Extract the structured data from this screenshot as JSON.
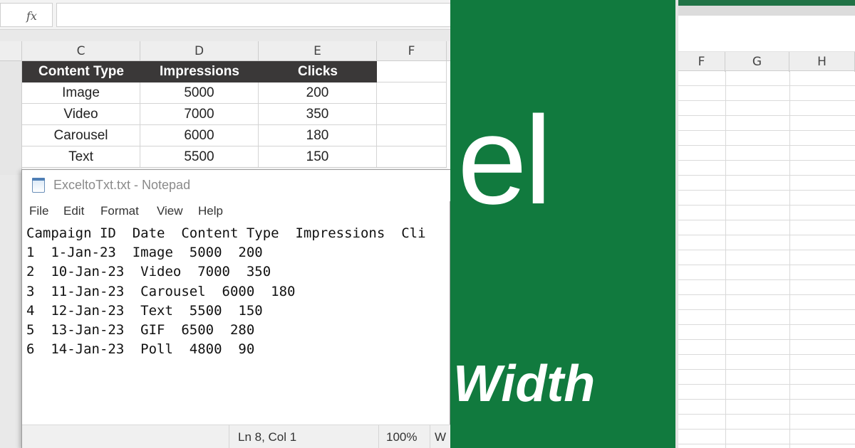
{
  "formula_bar": {
    "fx_label": "fx"
  },
  "sheet": {
    "column_headers": [
      "C",
      "D",
      "E",
      "F"
    ],
    "table_headers": [
      "Content Type",
      "Impressions",
      "Clicks"
    ],
    "rows": [
      [
        "Image",
        "5000",
        "200"
      ],
      [
        "Video",
        "7000",
        "350"
      ],
      [
        "Carousel",
        "6000",
        "180"
      ],
      [
        "Text",
        "5500",
        "150"
      ]
    ]
  },
  "notepad": {
    "title": "ExceltoTxt.txt - Notepad",
    "menu": [
      "File",
      "Edit",
      "Format",
      "View",
      "Help"
    ],
    "lines": [
      "Campaign ID  Date  Content Type  Impressions  Cli",
      "1  1-Jan-23  Image  5000  200",
      "2  10-Jan-23  Video  7000  350",
      "3  11-Jan-23  Carousel  6000  180",
      "4  12-Jan-23  Text  5500  150",
      "5  13-Jan-23  GIF  6500  280",
      "6  14-Jan-23  Poll  4800  90"
    ],
    "status": {
      "position": "Ln 8, Col 1",
      "zoom": "100%",
      "encoding_fragment": "W"
    }
  },
  "banner": {
    "brand_fragment": "el",
    "title_fragment": "Width",
    "background": "#117a3e"
  },
  "right_sheet": {
    "column_headers": [
      "F",
      "G",
      "H"
    ]
  }
}
